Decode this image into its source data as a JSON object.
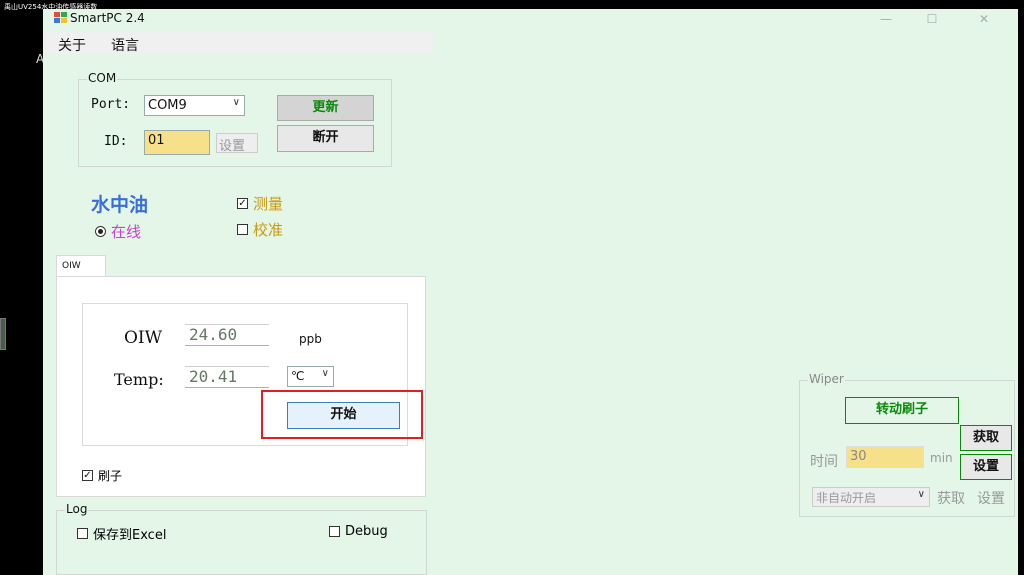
{
  "video_title": "禹山UV254水中油传感器读数",
  "side_letter": "A",
  "app": {
    "title": "SmartPC 2.4"
  },
  "window_controls": {
    "minimize": "—",
    "maximize": "☐",
    "close": "✕"
  },
  "menu": {
    "about": "关于",
    "language": "语言"
  },
  "com": {
    "group_label": "COM",
    "port_label": "Port:",
    "port_value": "COM9",
    "refresh_button": "更新",
    "id_label": "ID:",
    "id_value": "01",
    "set_button": "设置",
    "disconnect_button": "断开"
  },
  "mode": {
    "title": "水中油",
    "online_label": "在线",
    "online_selected": true,
    "measure_label": "测量",
    "measure_checked": true,
    "calibrate_label": "校准",
    "calibrate_checked": false
  },
  "oiw_tab": {
    "tab_label": "OIW",
    "oiw_label": "OIW",
    "oiw_value": "24.60",
    "oiw_unit": "ppb",
    "temp_label": "Temp:",
    "temp_value": "20.41",
    "temp_unit": "℃",
    "start_button": "开始",
    "brush_label": "刷子",
    "brush_checked": true
  },
  "log": {
    "group_label": "Log",
    "save_excel_label": "保存到Excel",
    "save_excel_checked": false,
    "debug_label": "Debug",
    "debug_checked": false
  },
  "wiper": {
    "group_label": "Wiper",
    "rotate_button": "转动刷子",
    "get_button": "获取",
    "time_label": "时间",
    "time_value": "30",
    "time_unit": "min",
    "set_button": "设置",
    "auto_mode_value": "非自动开启",
    "get_button_2": "获取",
    "set_button_2": "设置"
  },
  "colors": {
    "window_bg": "#e3f6e8",
    "accent_green": "#0a8a0a",
    "title_blue": "#3a6fd8",
    "online_magenta": "#d040d0",
    "mode_gold": "#c79a10",
    "id_field_bg": "#f7e08a",
    "highlight_red": "#e02020"
  }
}
